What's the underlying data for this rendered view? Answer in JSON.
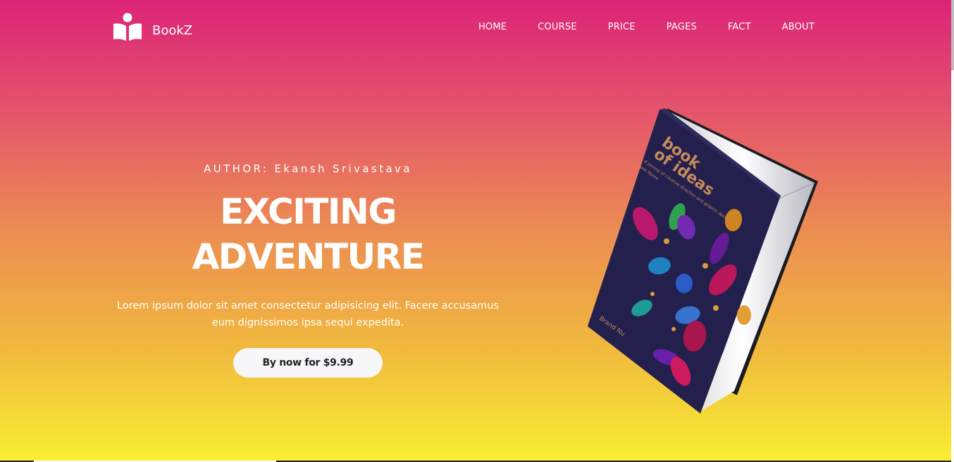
{
  "brand": {
    "name": "BookZ",
    "logo_icon": "open-book-reader-icon"
  },
  "nav": {
    "items": [
      {
        "label": "HOME"
      },
      {
        "label": "COURSE"
      },
      {
        "label": "PRICE"
      },
      {
        "label": "PAGES"
      },
      {
        "label": "FACT"
      },
      {
        "label": "ABOUT"
      }
    ]
  },
  "hero": {
    "author": "AUTHOR: Ekansh Srivastava",
    "title": "EXCITING ADVENTURE",
    "description": "Lorem ipsum dolor sit amet consectetur adipisicing elit. Facere accusamus eum dignissimos ipsa sequi expedita.",
    "cta_label": "By now for $9.99"
  },
  "book": {
    "cover_title_line1": "book",
    "cover_title_line2": "of ideas",
    "cover_subtitle": "A journal of creative direction and graphic design",
    "cover_author": "Book Name",
    "cover_brand": "Brand Nu"
  },
  "colors": {
    "gradient_top": "#dc2477",
    "gradient_bottom": "#f8ef33",
    "button_bg": "#f7f7f9",
    "book_cover": "#23204e"
  }
}
